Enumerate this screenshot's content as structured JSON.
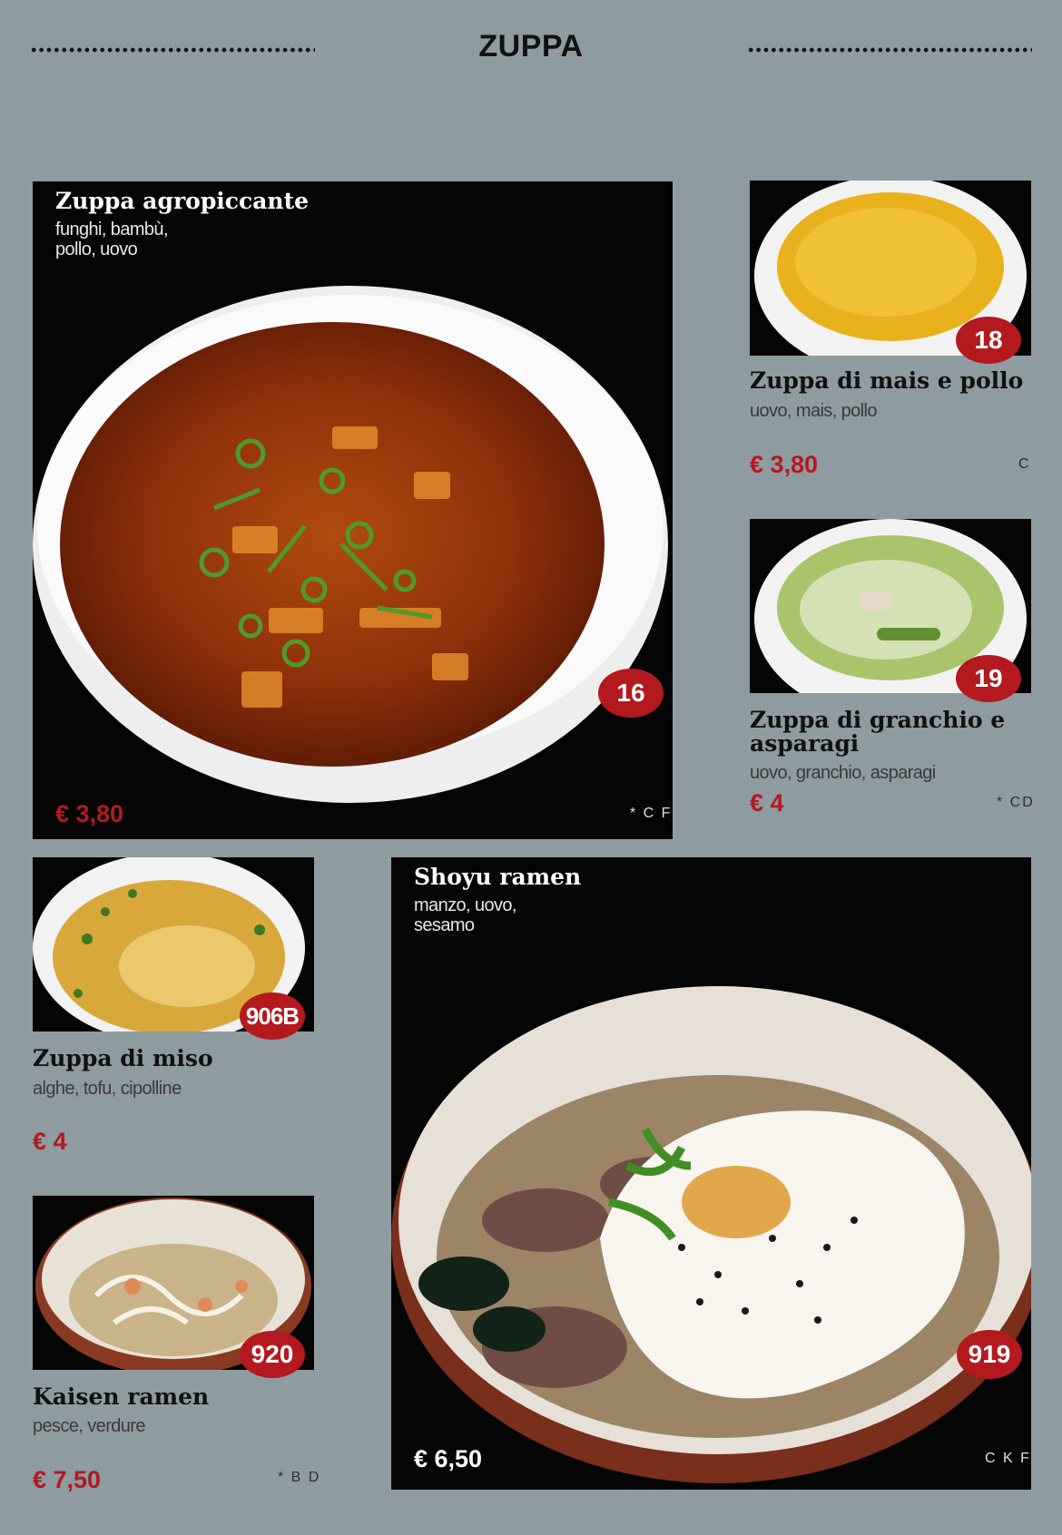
{
  "header": {
    "title": "ZUPPA"
  },
  "items": {
    "agropiccante": {
      "name": "Zuppa agropiccante",
      "desc_line1": "funghi, bambù,",
      "desc_line2": "pollo, uovo",
      "number": "16",
      "price": "€ 3,80",
      "allergens": "* C F"
    },
    "mais": {
      "name": "Zuppa di mais e pollo",
      "desc": "uovo, mais, pollo",
      "number": "18",
      "price": "€ 3,80",
      "allergens": "C"
    },
    "granchio": {
      "name_line1": "Zuppa di granchio e",
      "name_line2": "asparagi",
      "desc": "uovo, granchio, asparagi",
      "number": "19",
      "price": "€ 4",
      "allergens": "* CD"
    },
    "miso": {
      "name": "Zuppa di miso",
      "desc": "alghe, tofu, cipolline",
      "number": "906B",
      "price": "€ 4"
    },
    "kaisen": {
      "name": "Kaisen ramen",
      "desc": "pesce, verdure",
      "number": "920",
      "price": "€ 7,50",
      "allergens": "* B D"
    },
    "shoyu": {
      "name": "Shoyu ramen",
      "desc_line1": "manzo, uovo,",
      "desc_line2": "sesamo",
      "number": "919",
      "price": "€ 6,50",
      "allergens": "C K F"
    }
  },
  "colors": {
    "background": "#8e9ba1",
    "accent_red": "#b3191f",
    "photo_bg": "#050505"
  }
}
